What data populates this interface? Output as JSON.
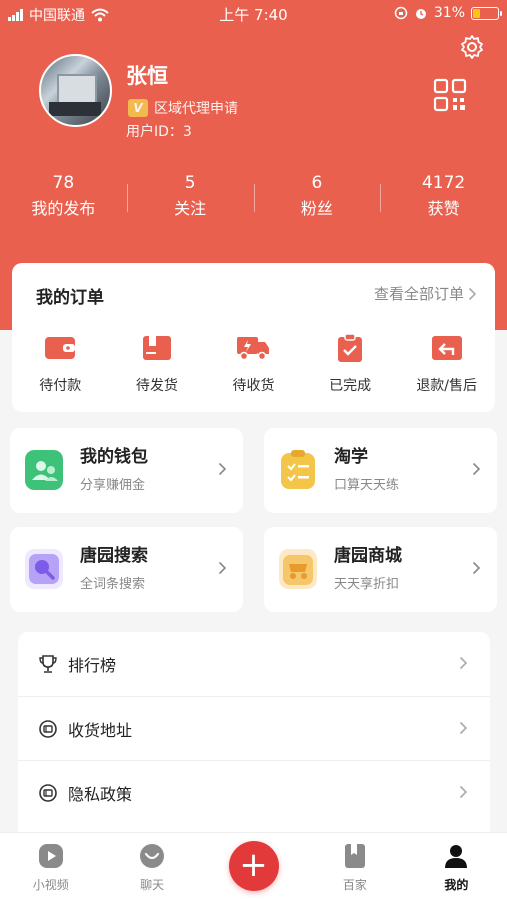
{
  "status_bar": {
    "carrier": "中国联通",
    "time": "上午 7:40",
    "battery_percent": "31%",
    "battery_level": 0.31
  },
  "profile": {
    "name": "张恒",
    "agent_badge": "V",
    "agent_link": "区域代理申请",
    "user_id": "用户ID：3"
  },
  "stats": [
    {
      "value": "78",
      "label": "我的发布"
    },
    {
      "value": "5",
      "label": "关注"
    },
    {
      "value": "6",
      "label": "粉丝"
    },
    {
      "value": "4172",
      "label": "获赞"
    }
  ],
  "orders": {
    "title": "我的订单",
    "view_all": "查看全部订单",
    "items": [
      {
        "label": "待付款",
        "icon": "wallet-icon"
      },
      {
        "label": "待发货",
        "icon": "box-icon"
      },
      {
        "label": "待收货",
        "icon": "truck-icon"
      },
      {
        "label": "已完成",
        "icon": "clipboard-check-icon"
      },
      {
        "label": "退款/售后",
        "icon": "refund-icon"
      }
    ]
  },
  "tiles": [
    {
      "title": "我的钱包",
      "subtitle": "分享赚佣金",
      "icon": "wallet-people-icon",
      "color": "#3ec27a"
    },
    {
      "title": "淘学",
      "subtitle": "口算天天练",
      "icon": "checklist-icon",
      "color": "#f3c64a"
    },
    {
      "title": "唐园搜索",
      "subtitle": "全词条搜索",
      "icon": "search-icon",
      "color": "#8a6df0"
    },
    {
      "title": "唐园商城",
      "subtitle": "天天享折扣",
      "icon": "shop-icon",
      "color": "#f6c66b"
    }
  ],
  "menu": [
    {
      "label": "排行榜",
      "icon": "trophy-icon"
    },
    {
      "label": "收货地址",
      "icon": "address-icon"
    },
    {
      "label": "隐私政策",
      "icon": "privacy-icon"
    }
  ],
  "nav": [
    {
      "label": "小视频",
      "icon": "play-icon"
    },
    {
      "label": "聊天",
      "icon": "chat-icon"
    },
    {
      "label": "",
      "icon": "plus-icon"
    },
    {
      "label": "百家",
      "icon": "book-icon"
    },
    {
      "label": "我的",
      "icon": "person-icon"
    }
  ],
  "colors": {
    "brand": "#e9604f",
    "plus": "#e23a3a"
  }
}
